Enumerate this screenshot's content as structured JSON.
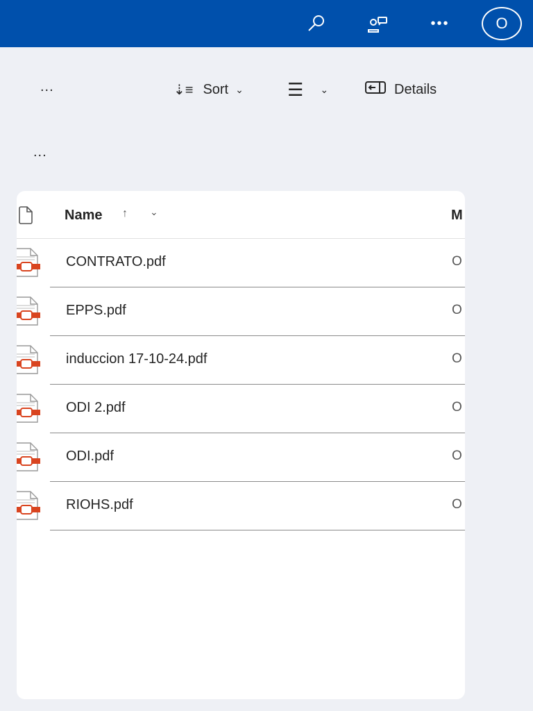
{
  "header": {
    "avatar_initial": "O"
  },
  "toolbar": {
    "more": "...",
    "sort": "Sort",
    "details": "Details",
    "more2": "..."
  },
  "table": {
    "name_header": "Name",
    "modified_header": "M",
    "files": [
      {
        "name": "CONTRATO.pdf",
        "modified": "O"
      },
      {
        "name": "EPPS.pdf",
        "modified": "O"
      },
      {
        "name": "induccion 17-10-24.pdf",
        "modified": "O"
      },
      {
        "name": "ODI 2.pdf",
        "modified": "O"
      },
      {
        "name": "ODI.pdf",
        "modified": "O"
      },
      {
        "name": "RIOHS.pdf",
        "modified": "O"
      }
    ]
  },
  "colors": {
    "brand": "#0050ac",
    "pdf": "#d9441f"
  }
}
